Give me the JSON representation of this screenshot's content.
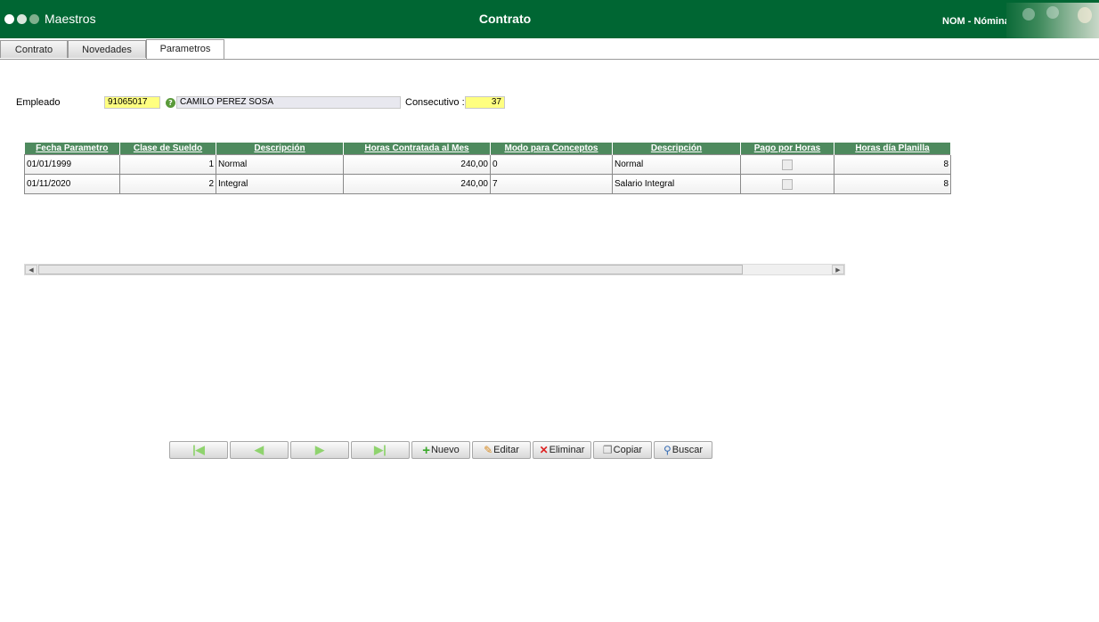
{
  "header": {
    "app_name": "Maestros",
    "page_title": "Contrato",
    "module": "NOM - Nómina",
    "dots_colors": [
      "#ffffff",
      "#d9e6dc",
      "#7fb08d"
    ]
  },
  "tabs": [
    {
      "label": "Contrato",
      "active": false
    },
    {
      "label": "Novedades",
      "active": false
    },
    {
      "label": "Parametros",
      "active": true
    }
  ],
  "form": {
    "empleado_label": "Empleado",
    "empleado_code": "91065017",
    "empleado_name": "CAMILO PEREZ SOSA",
    "consecutivo_label": "Consecutivo :",
    "consecutivo_value": "37"
  },
  "grid": {
    "columns": [
      "Fecha Parametro",
      "Clase de Sueldo",
      "Descripción",
      "Horas Contratada al Mes",
      "Modo para Conceptos",
      "Descripción",
      "Pago por Horas",
      "Horas día Planilla"
    ],
    "rows": [
      {
        "fecha": "01/01/1999",
        "clase": "1",
        "descripcion": "Normal",
        "horas_mes": "240,00",
        "modo": "0",
        "descripcion2": "Normal",
        "pago_horas": false,
        "horas_dia": "8"
      },
      {
        "fecha": "01/11/2020",
        "clase": "2",
        "descripcion": "Integral",
        "horas_mes": "240,00",
        "modo": "7",
        "descripcion2": "Salario Integral",
        "pago_horas": false,
        "horas_dia": "8"
      }
    ]
  },
  "toolbar": {
    "nuevo": "Nuevo",
    "editar": "Editar",
    "eliminar": "Eliminar",
    "copiar": "Copiar",
    "buscar": "Buscar"
  },
  "colors": {
    "header_bg": "#006633",
    "grid_header_bg": "#4e8a5e",
    "highlight_field": "#ffff80"
  }
}
